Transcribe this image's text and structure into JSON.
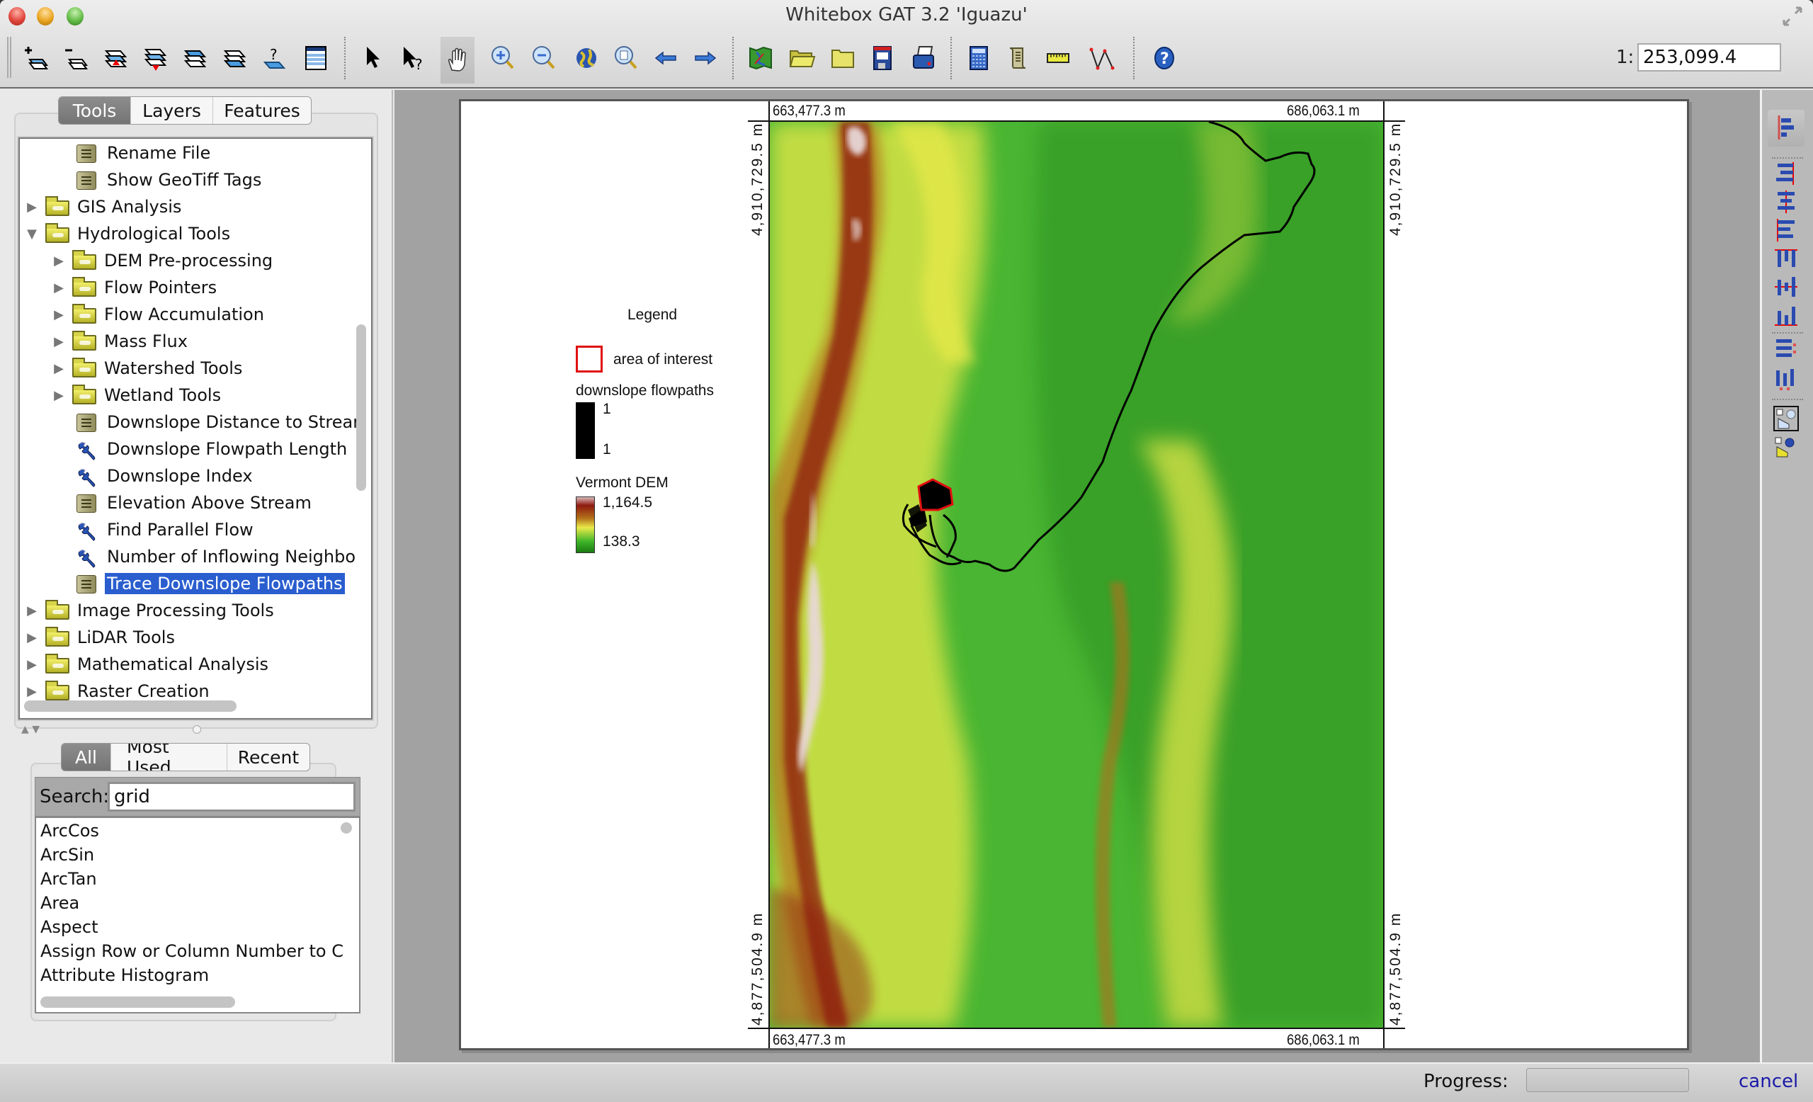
{
  "window": {
    "title": "Whitebox GAT 3.2 'Iguazu'"
  },
  "toolbar": {
    "buttons": [
      {
        "name": "add-layer-button",
        "icon": "add-layer-icon"
      },
      {
        "name": "remove-layer-button",
        "icon": "remove-layer-icon"
      },
      {
        "name": "raise-layer-button",
        "icon": "raise-layer-icon"
      },
      {
        "name": "lower-layer-button",
        "icon": "lower-layer-icon"
      },
      {
        "name": "layer-to-top-button",
        "icon": "layer-top-icon"
      },
      {
        "name": "layer-to-bottom-button",
        "icon": "layer-bottom-icon"
      },
      {
        "name": "layer-properties-button",
        "icon": "layer-query-icon"
      },
      {
        "name": "attribute-table-button",
        "icon": "table-icon"
      },
      {
        "name": "select-button",
        "icon": "pointer-icon"
      },
      {
        "name": "identify-button",
        "icon": "pointer-question-icon"
      },
      {
        "name": "pan-button",
        "icon": "hand-icon"
      },
      {
        "name": "zoom-in-button",
        "icon": "zoom-in-icon"
      },
      {
        "name": "zoom-out-button",
        "icon": "zoom-out-icon"
      },
      {
        "name": "zoom-full-extent-button",
        "icon": "globe-icon"
      },
      {
        "name": "zoom-to-page-button",
        "icon": "zoom-page-icon"
      },
      {
        "name": "previous-extent-button",
        "icon": "arrow-left-icon"
      },
      {
        "name": "next-extent-button",
        "icon": "arrow-right-icon"
      },
      {
        "name": "new-map-button",
        "icon": "map-icon"
      },
      {
        "name": "open-map-button",
        "icon": "folder-open-icon"
      },
      {
        "name": "open-folder-button",
        "icon": "folder-icon"
      },
      {
        "name": "save-map-button",
        "icon": "save-icon"
      },
      {
        "name": "print-map-button",
        "icon": "print-icon"
      },
      {
        "name": "raster-calculator-button",
        "icon": "calculator-icon"
      },
      {
        "name": "scripter-button",
        "icon": "scroll-icon"
      },
      {
        "name": "measure-distance-button",
        "icon": "ruler-icon"
      },
      {
        "name": "digitize-button",
        "icon": "polyline-icon"
      },
      {
        "name": "help-button",
        "icon": "help-icon"
      }
    ],
    "active_tool": "pan-button",
    "scale_prefix": "1:",
    "scale_value": "253,099.4"
  },
  "left_panel": {
    "tabs": [
      {
        "label": "Tools",
        "selected": true
      },
      {
        "label": "Layers",
        "selected": false
      },
      {
        "label": "Features",
        "selected": false
      }
    ],
    "tree": [
      {
        "label": "Rename File",
        "type": "script",
        "level": 2
      },
      {
        "label": "Show GeoTiff Tags",
        "type": "script",
        "level": 2
      },
      {
        "label": "GIS Analysis",
        "type": "folder",
        "level": 1,
        "expanded": false
      },
      {
        "label": "Hydrological Tools",
        "type": "folder",
        "level": 1,
        "expanded": true
      },
      {
        "label": "DEM Pre-processing",
        "type": "folder",
        "level": 2,
        "expanded": false
      },
      {
        "label": "Flow Pointers",
        "type": "folder",
        "level": 2,
        "expanded": false
      },
      {
        "label": "Flow Accumulation",
        "type": "folder",
        "level": 2,
        "expanded": false
      },
      {
        "label": "Mass Flux",
        "type": "folder",
        "level": 2,
        "expanded": false
      },
      {
        "label": "Watershed Tools",
        "type": "folder",
        "level": 2,
        "expanded": false
      },
      {
        "label": "Wetland Tools",
        "type": "folder",
        "level": 2,
        "expanded": false
      },
      {
        "label": "Downslope Distance to Strear",
        "type": "script",
        "level": 2
      },
      {
        "label": "Downslope Flowpath Length",
        "type": "tool",
        "level": 2
      },
      {
        "label": "Downslope Index",
        "type": "tool",
        "level": 2
      },
      {
        "label": "Elevation Above Stream",
        "type": "script",
        "level": 2
      },
      {
        "label": "Find Parallel Flow",
        "type": "tool",
        "level": 2
      },
      {
        "label": "Number of Inflowing Neighbo",
        "type": "tool",
        "level": 2
      },
      {
        "label": "Trace Downslope Flowpaths",
        "type": "script",
        "level": 2,
        "selected": true
      },
      {
        "label": "Image Processing Tools",
        "type": "folder",
        "level": 1,
        "expanded": false
      },
      {
        "label": "LiDAR Tools",
        "type": "folder",
        "level": 1,
        "expanded": false
      },
      {
        "label": "Mathematical Analysis",
        "type": "folder",
        "level": 1,
        "expanded": false
      },
      {
        "label": "Raster Creation",
        "type": "folder",
        "level": 1,
        "expanded": false
      }
    ],
    "list_tabs": [
      {
        "label": "All",
        "selected": true
      },
      {
        "label": "Most Used",
        "selected": false
      },
      {
        "label": "Recent",
        "selected": false
      }
    ],
    "search_label": "Search:",
    "search_value": "grid",
    "tool_list": [
      "ArcCos",
      "ArcSin",
      "ArcTan",
      "Area",
      "Aspect",
      "Assign Row or Column Number to C",
      "Attribute Histogram"
    ]
  },
  "map": {
    "legend": {
      "title": "Legend",
      "entries": [
        {
          "label": "area of interest",
          "type": "polygon",
          "color": "#e01010"
        },
        {
          "label": "downslope flowpaths",
          "type": "raster",
          "max": "1",
          "min": "1",
          "color": "#000000"
        },
        {
          "label": "Vermont DEM",
          "type": "raster",
          "max": "1,164.5",
          "min": "138.3"
        }
      ]
    },
    "extent": {
      "west": "663,477.3 m",
      "east": "686,063.1 m",
      "north": "4,910,729.5 m",
      "south": "4,877,504.9 m"
    },
    "palette": {
      "high": "#e8d8d8",
      "upper": "#8e1a10",
      "mid_high": "#b2701a",
      "mid": "#eaea4a",
      "low": "#3fb52a",
      "lowest": "#1a7a12",
      "aoi": "#e01010",
      "flowpath": "#000000"
    }
  },
  "status_bar": {
    "progress_label": "Progress:",
    "progress_value": 0,
    "cancel_label": "cancel"
  }
}
